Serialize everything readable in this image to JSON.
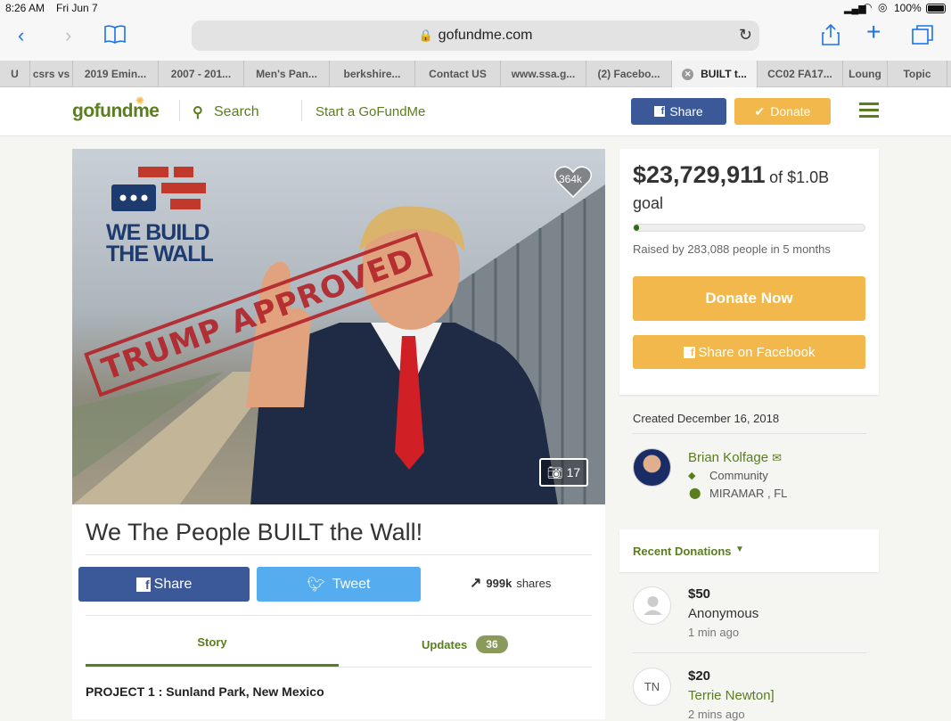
{
  "status": {
    "time": "8:26 AM",
    "date": "Fri Jun 7",
    "battery": "100%"
  },
  "browser": {
    "url": "gofundme.com"
  },
  "tabs": [
    {
      "label": "U",
      "w": 34
    },
    {
      "label": "csrs vs",
      "w": 48
    },
    {
      "label": "2019 Emin...",
      "w": 96
    },
    {
      "label": "2007 - 201...",
      "w": 96
    },
    {
      "label": "Men's Pan...",
      "w": 96
    },
    {
      "label": "berkshire...",
      "w": 96
    },
    {
      "label": "Contact US",
      "w": 96
    },
    {
      "label": "www.ssa.g...",
      "w": 96
    },
    {
      "label": "(2) Facebo...",
      "w": 96
    },
    {
      "label": "BUILT t...",
      "w": 96,
      "active": true
    },
    {
      "label": "CC02 FA17...",
      "w": 96
    },
    {
      "label": "Loung",
      "w": 50
    },
    {
      "label": "Topic",
      "w": 67
    }
  ],
  "header": {
    "logo": "gofundme",
    "search": "Search",
    "start": "Start a GoFundMe",
    "share": "Share",
    "donate": "Donate"
  },
  "hero": {
    "likes": "364k",
    "photos": "17",
    "logo_line1": "WE BUILD",
    "logo_line2": "THE WALL",
    "stamp": "TRUMP APPROVED"
  },
  "campaign": {
    "title": "We The People BUILT the Wall!",
    "share_btn": "Share",
    "tweet_btn": "Tweet",
    "shares_count": "999k",
    "shares_label": "shares",
    "tab_story": "Story",
    "tab_updates": "Updates",
    "updates_count": "36",
    "project_heading": "PROJECT 1 : Sunland Park, New Mexico"
  },
  "funding": {
    "raised": "$23,729,911",
    "of": "of $1.0B",
    "goal": "goal",
    "progress": 0.024,
    "raised_by": "Raised by 283,088 people in 5 months",
    "donate_now": "Donate Now",
    "share_facebook": "Share on Facebook"
  },
  "organizer": {
    "created": "Created December 16, 2018",
    "name": "Brian Kolfage",
    "category": "Community",
    "location": "MIRAMAR , FL"
  },
  "recent": {
    "heading": "Recent Donations",
    "donations": [
      {
        "amount": "$50",
        "name": "Anonymous",
        "time": "1 min ago"
      },
      {
        "amount": "$20",
        "name": "Terrie Newton]",
        "time": "2 mins ago",
        "initials": "TN"
      }
    ]
  },
  "colors": {
    "green": "#5a7d1e",
    "facebook": "#3b5998",
    "twitter": "#55acee",
    "gold": "#f2b84b"
  }
}
